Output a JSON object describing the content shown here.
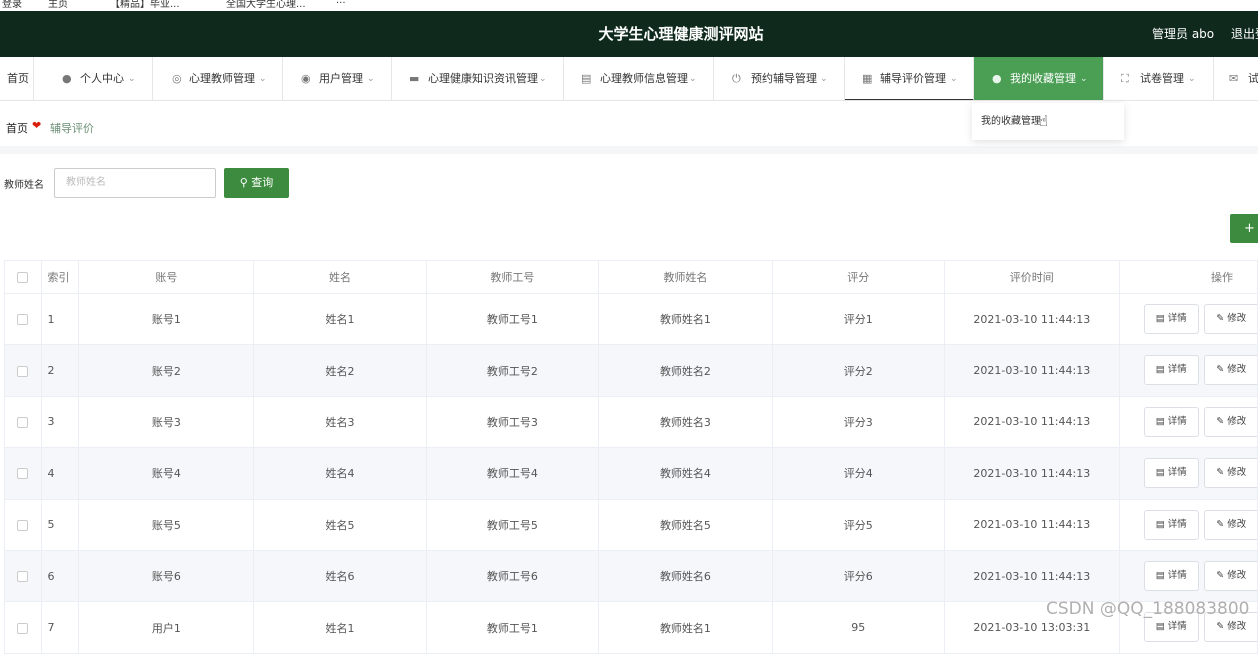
{
  "browser_bar": [
    "登录",
    "主页",
    "【精品】毕业...",
    "全国大学生心理...",
    "..."
  ],
  "header": {
    "title": "大学生心理健康测评网站",
    "user": "管理员 abo",
    "logout": "退出登录"
  },
  "nav": [
    {
      "label": "首页",
      "icon": "home-icon",
      "chevron": false
    },
    {
      "label": "个人中心",
      "icon": "person-icon",
      "chevron": true
    },
    {
      "label": "心理教师管理",
      "icon": "microphone-icon",
      "chevron": true
    },
    {
      "label": "用户管理",
      "icon": "location-pin-icon",
      "chevron": true
    },
    {
      "label": "心理健康知识资讯管理",
      "icon": "monitor-icon",
      "chevron": true
    },
    {
      "label": "心理教师信息管理",
      "icon": "clipboard-icon",
      "chevron": true
    },
    {
      "label": "预约辅导管理",
      "icon": "power-icon",
      "chevron": true
    },
    {
      "label": "辅导评价管理",
      "icon": "document-icon",
      "chevron": true
    },
    {
      "label": "我的收藏管理",
      "icon": "person-icon",
      "chevron": true
    },
    {
      "label": "试卷管理",
      "icon": "fullscreen-icon",
      "chevron": true
    },
    {
      "label": "试",
      "icon": "message-icon",
      "chevron": false
    }
  ],
  "dropdown": {
    "item": "我的收藏管理"
  },
  "breadcrumb": {
    "home": "首页",
    "current": "辅导评价"
  },
  "search": {
    "label": "教师姓名",
    "placeholder": "教师姓名",
    "button": "查询"
  },
  "add_button": "+",
  "table": {
    "columns": [
      "索引",
      "账号",
      "姓名",
      "教师工号",
      "教师姓名",
      "评分",
      "评价时间",
      "操作"
    ],
    "rows": [
      {
        "index": "1",
        "account": "账号1",
        "name": "姓名1",
        "teacher_no": "教师工号1",
        "teacher_name": "教师姓名1",
        "score": "评分1",
        "time": "2021-03-10 11:44:13"
      },
      {
        "index": "2",
        "account": "账号2",
        "name": "姓名2",
        "teacher_no": "教师工号2",
        "teacher_name": "教师姓名2",
        "score": "评分2",
        "time": "2021-03-10 11:44:13"
      },
      {
        "index": "3",
        "account": "账号3",
        "name": "姓名3",
        "teacher_no": "教师工号3",
        "teacher_name": "教师姓名3",
        "score": "评分3",
        "time": "2021-03-10 11:44:13"
      },
      {
        "index": "4",
        "account": "账号4",
        "name": "姓名4",
        "teacher_no": "教师工号4",
        "teacher_name": "教师姓名4",
        "score": "评分4",
        "time": "2021-03-10 11:44:13"
      },
      {
        "index": "5",
        "account": "账号5",
        "name": "姓名5",
        "teacher_no": "教师工号5",
        "teacher_name": "教师姓名5",
        "score": "评分5",
        "time": "2021-03-10 11:44:13"
      },
      {
        "index": "6",
        "account": "账号6",
        "name": "姓名6",
        "teacher_no": "教师工号6",
        "teacher_name": "教师姓名6",
        "score": "评分6",
        "time": "2021-03-10 11:44:13"
      },
      {
        "index": "7",
        "account": "用户1",
        "name": "姓名1",
        "teacher_no": "教师工号1",
        "teacher_name": "教师姓名1",
        "score": "95",
        "time": "2021-03-10 13:03:31"
      }
    ],
    "actions": {
      "detail": "详情",
      "edit": "修改"
    }
  },
  "watermark": "CSDN @QQ_188083800",
  "colors": {
    "header_bg": "#0f2a1d",
    "active_nav": "#4a9f55",
    "primary_button": "#3c8b3e",
    "heart": "#d81e06"
  }
}
